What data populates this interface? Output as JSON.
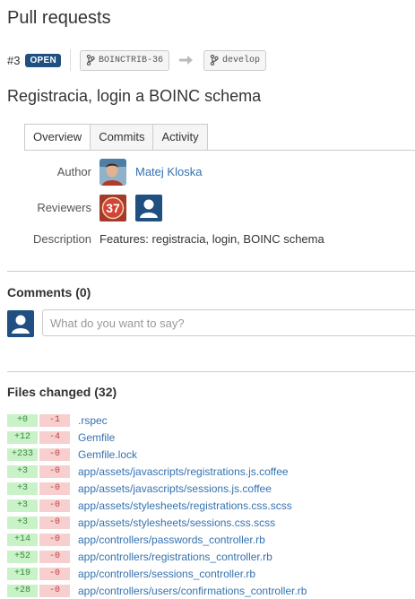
{
  "page": {
    "title": "Pull requests"
  },
  "pr": {
    "number": "#3",
    "state": "OPEN",
    "source_branch": "BOINCTRIB-36",
    "target_branch": "develop",
    "title": "Registracia, login a BOINC schema"
  },
  "tabs": [
    {
      "label": "Overview",
      "active": true
    },
    {
      "label": "Commits",
      "active": false
    },
    {
      "label": "Activity",
      "active": false
    }
  ],
  "details": {
    "author_label": "Author",
    "author_name": "Matej Kloska",
    "reviewers_label": "Reviewers",
    "reviewer_badge": "37",
    "description_label": "Description",
    "description": "Features: registracia, login, BOINC schema"
  },
  "comments": {
    "heading": "Comments (0)",
    "placeholder": "What do you want to say?"
  },
  "files": {
    "heading": "Files changed (32)",
    "items": [
      {
        "added": "+0",
        "removed": "-1",
        "path": ".rspec"
      },
      {
        "added": "+12",
        "removed": "-4",
        "path": "Gemfile"
      },
      {
        "added": "+233",
        "removed": "-0",
        "path": "Gemfile.lock"
      },
      {
        "added": "+3",
        "removed": "-0",
        "path": "app/assets/javascripts/registrations.js.coffee"
      },
      {
        "added": "+3",
        "removed": "-0",
        "path": "app/assets/javascripts/sessions.js.coffee"
      },
      {
        "added": "+3",
        "removed": "-0",
        "path": "app/assets/stylesheets/registrations.css.scss"
      },
      {
        "added": "+3",
        "removed": "-0",
        "path": "app/assets/stylesheets/sessions.css.scss"
      },
      {
        "added": "+14",
        "removed": "-0",
        "path": "app/controllers/passwords_controller.rb"
      },
      {
        "added": "+52",
        "removed": "-0",
        "path": "app/controllers/registrations_controller.rb"
      },
      {
        "added": "+19",
        "removed": "-0",
        "path": "app/controllers/sessions_controller.rb"
      },
      {
        "added": "+28",
        "removed": "-0",
        "path": "app/controllers/users/confirmations_controller.rb"
      }
    ]
  },
  "colors": {
    "link": "#3572b0",
    "badge_open": "#205081",
    "added_bg": "#c9f2c9",
    "removed_bg": "#f8cfcf"
  },
  "icons": {
    "branch": "branch-icon",
    "arrow": "arrow-right-icon",
    "user": "user-icon"
  }
}
